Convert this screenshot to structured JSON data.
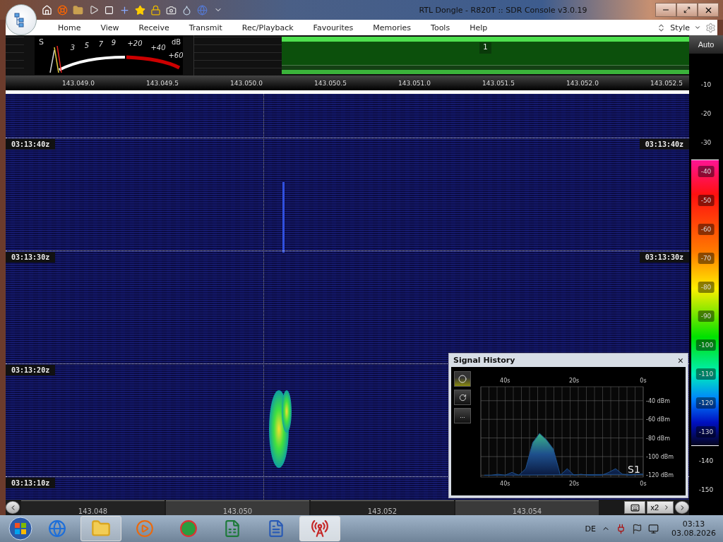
{
  "window": {
    "title": "RTL Dongle - R820T :: SDR Console v3.0.19"
  },
  "menu": [
    "Home",
    "View",
    "Receive",
    "Transmit",
    "Rec/Playback",
    "Favourites",
    "Memories",
    "Tools",
    "Help"
  ],
  "style_label": "Style",
  "s_meter": {
    "s_label": "S",
    "db_label": "dB",
    "scale": [
      "3",
      "5",
      "7",
      "9",
      "+20",
      "+40",
      "+60"
    ]
  },
  "spectrum": {
    "marker": "1"
  },
  "frequency_scale": [
    "143.049.0",
    "143.049.5",
    "143.050.0",
    "143.050.5",
    "143.051.0",
    "143.051.5",
    "143.052.0",
    "143.052.5"
  ],
  "waterfall": {
    "times": [
      {
        "left": "03:13:40z",
        "right": "03:13:40z"
      },
      {
        "left": "03:13:30z",
        "right": "03:13:30z"
      },
      {
        "left": "03:13:20z"
      },
      {
        "left": "03:13:10z"
      }
    ]
  },
  "signal_history": {
    "title": "Signal History",
    "close": "×",
    "buttons": [
      {
        "kind": "record",
        "selected": true
      },
      {
        "kind": "refresh",
        "selected": false
      },
      {
        "kind": "more",
        "label": "...",
        "selected": false
      }
    ],
    "chart_data": {
      "type": "area",
      "grid": true,
      "x": [
        46,
        44,
        42,
        40,
        38,
        36,
        34,
        32,
        30,
        28,
        26,
        24,
        22,
        20,
        18,
        16,
        14,
        12,
        10,
        8,
        6,
        4,
        2,
        0
      ],
      "xlim": [
        47,
        0
      ],
      "ylim": [
        -122,
        -25
      ],
      "xticks": [
        {
          "value": 40,
          "label": "40s"
        },
        {
          "value": 20,
          "label": "20s"
        },
        {
          "value": 0,
          "label": "0s"
        }
      ],
      "yticks": [
        {
          "value": -40,
          "label": "-40 dBm"
        },
        {
          "value": -60,
          "label": "-60 dBm"
        },
        {
          "value": -80,
          "label": "-80 dBm"
        },
        {
          "value": -100,
          "label": "-100 dBm"
        },
        {
          "value": -120,
          "label": "-120 dBm"
        }
      ],
      "series": [
        {
          "name": "S1",
          "color": "#1e4f8c",
          "values": [
            -120,
            -120,
            -119,
            -120,
            -117,
            -120,
            -113,
            -85,
            -75,
            -82,
            -92,
            -120,
            -113,
            -120,
            -119,
            -120,
            -120,
            -120,
            -117,
            -113,
            -119,
            -120,
            -119,
            -119
          ]
        }
      ]
    }
  },
  "colorbar": {
    "mode": "Auto",
    "labels": [
      "-10",
      "-20",
      "-30",
      "-40",
      "-50",
      "-60",
      "-70",
      "-80",
      "-90",
      "-100",
      "-110",
      "-120",
      "-130",
      "-140",
      "-150"
    ]
  },
  "bottom_scale": {
    "labels": [
      "143.048",
      "143.050",
      "143.052",
      "143.054"
    ],
    "zoom": "x2"
  },
  "taskbar": {
    "apps": [
      {
        "kind": "browser",
        "running": false,
        "selected": false
      },
      {
        "kind": "folder",
        "running": true,
        "selected": false
      },
      {
        "kind": "media",
        "running": false,
        "selected": false
      },
      {
        "kind": "chrome",
        "running": false,
        "selected": false
      },
      {
        "kind": "sheet",
        "running": false,
        "selected": false
      },
      {
        "kind": "doc",
        "running": false,
        "selected": false
      },
      {
        "kind": "radio",
        "running": true,
        "selected": true
      }
    ],
    "language": "DE",
    "time": "03:13",
    "date": "03.08.2026"
  }
}
